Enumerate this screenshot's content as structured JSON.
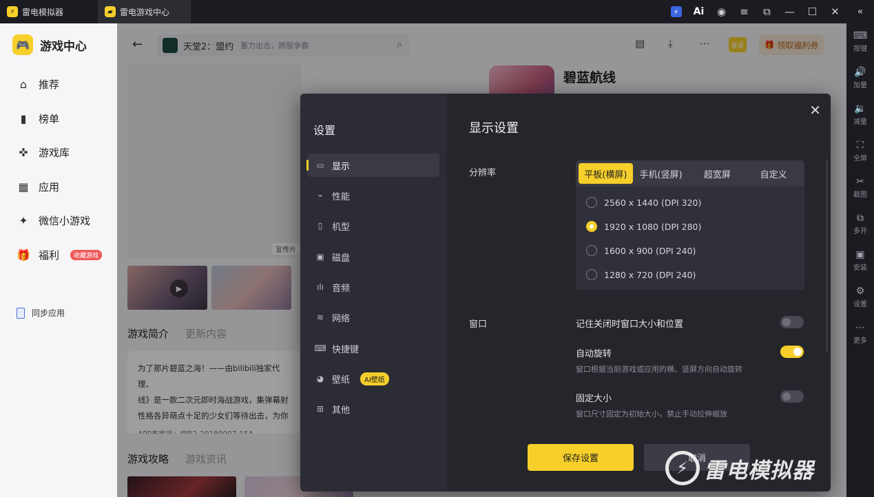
{
  "titlebar": {
    "tabs": [
      {
        "label": "雷电模拟器",
        "logo": "bolt"
      },
      {
        "label": "雷电游戏中心",
        "logo": "gamepad"
      }
    ],
    "ai_label": "Ai"
  },
  "righttool": {
    "items": [
      {
        "label": "按键",
        "icon": "keyboard-icon"
      },
      {
        "label": "加量",
        "icon": "volume-up-icon"
      },
      {
        "label": "减量",
        "icon": "volume-down-icon"
      },
      {
        "label": "全屏",
        "icon": "fullscreen-icon"
      },
      {
        "label": "截图",
        "icon": "scissors-icon"
      },
      {
        "label": "多开",
        "icon": "multi-instance-icon"
      },
      {
        "label": "安装",
        "icon": "apk-install-icon"
      },
      {
        "label": "设置",
        "icon": "gear-icon"
      },
      {
        "label": "更多",
        "icon": "more-icon"
      }
    ]
  },
  "sidebar": {
    "brand": "游戏中心",
    "items": [
      {
        "label": "推荐",
        "icon": "home-icon"
      },
      {
        "label": "榜单",
        "icon": "ranking-icon"
      },
      {
        "label": "游戏库",
        "icon": "gamepad-icon"
      },
      {
        "label": "应用",
        "icon": "apps-icon"
      },
      {
        "label": "微信小游戏",
        "icon": "wechat-game-icon"
      },
      {
        "label": "福利",
        "icon": "gift-icon",
        "badge": "收藏游戏"
      }
    ],
    "sync_label": "同步应用"
  },
  "main": {
    "search": {
      "title": "天堂2：盟约",
      "subtitle": "蓄力出击，跨服争霸"
    },
    "login_label": "登录",
    "welfare_label": "领取福利券",
    "banner_tag": "宣传片",
    "game_title": "碧蓝航线",
    "tabs1": [
      "游戏简介",
      "更新内容"
    ],
    "intro": {
      "lines": [
        "为了那片碧蓝之海！——由bilibili独家代理、",
        "线》是一款二次元即时海战游戏，集弹幕射",
        "性格各异萌点十足的少女们等待出击，为你"
      ],
      "meta": "APP备案号：皖B2-20180007-15A"
    },
    "tabs2": [
      "游戏攻略",
      "游戏资讯"
    ]
  },
  "dialog": {
    "heading": "设置",
    "menu": [
      {
        "label": "显示",
        "icon": "monitor-icon"
      },
      {
        "label": "性能",
        "icon": "performance-icon"
      },
      {
        "label": "机型",
        "icon": "phone-icon"
      },
      {
        "label": "磁盘",
        "icon": "disk-icon"
      },
      {
        "label": "音频",
        "icon": "audio-icon"
      },
      {
        "label": "网络",
        "icon": "wifi-icon"
      },
      {
        "label": "快捷键",
        "icon": "keyboard-icon"
      },
      {
        "label": "壁纸",
        "icon": "palette-icon",
        "badge": "AI壁纸"
      },
      {
        "label": "其他",
        "icon": "grid-icon"
      }
    ],
    "section_title": "显示设置",
    "resolution": {
      "label": "分辨率",
      "tabs": [
        "平板(横屏)",
        "手机(竖屏)",
        "超宽屏",
        "自定义"
      ],
      "options": [
        {
          "label": "2560 x 1440  (DPI 320)",
          "selected": false
        },
        {
          "label": "1920 x 1080  (DPI 280)",
          "selected": true
        },
        {
          "label": "1600 x 900  (DPI 240)",
          "selected": false
        },
        {
          "label": "1280 x 720  (DPI 240)",
          "selected": false
        }
      ]
    },
    "window": {
      "label": "窗口",
      "toggles": [
        {
          "label": "记住关闭时窗口大小和位置",
          "desc": "",
          "on": false
        },
        {
          "label": "自动旋转",
          "desc": "窗口根据当前游戏或应用的横、竖屏方向自动旋转",
          "on": true
        },
        {
          "label": "固定大小",
          "desc": "窗口尺寸固定为初始大小，禁止手动拉伸缩放",
          "on": false
        }
      ]
    },
    "save_label": "保存设置",
    "cancel_label": "取消"
  },
  "watermark": "雷电模拟器",
  "colors": {
    "accent": "#f6cf2a",
    "dialog_bg": "#25252c",
    "sidebar_bg": "#f6f6f8"
  }
}
